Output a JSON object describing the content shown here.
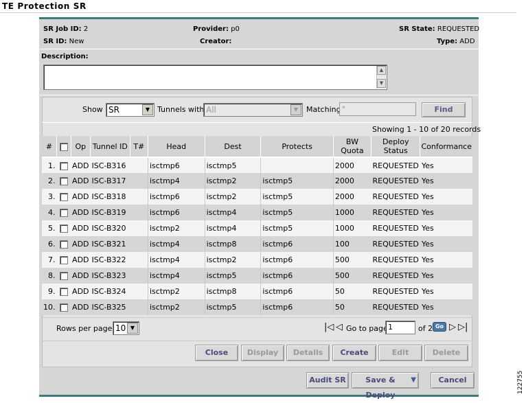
{
  "page": {
    "title": "TE Protection SR",
    "figure_number": "122755"
  },
  "header": {
    "sr_job_id_label": "SR Job ID:",
    "sr_job_id": "2",
    "provider_label": "Provider:",
    "provider": "p0",
    "sr_state_label": "SR State:",
    "sr_state": "REQUESTED",
    "sr_id_label": "SR ID:",
    "sr_id": "New",
    "creator_label": "Creator:",
    "creator": "",
    "type_label": "Type:",
    "type": "ADD"
  },
  "description": {
    "label": "Description:",
    "value": ""
  },
  "filter": {
    "show_label": "Show",
    "show_value": "SR",
    "tunnels_label": "Tunnels with",
    "tunnels_value": "All",
    "matching_label": "Matching",
    "matching_placeholder": "*",
    "find_label": "Find"
  },
  "records_text": "Showing 1 - 10 of 20 records",
  "table": {
    "columns": [
      "#",
      "",
      "Op",
      "Tunnel ID",
      "T#",
      "Head",
      "Dest",
      "Protects",
      "BW Quota",
      "Deploy Status",
      "Conformance"
    ],
    "rows": [
      {
        "n": "1.",
        "op": "ADD",
        "tunnel": "ISC-B316",
        "t": "",
        "head": "isctmp6",
        "dest": "isctmp5",
        "protects": "",
        "bw": "2000",
        "status": "REQUESTED",
        "conf": "Yes"
      },
      {
        "n": "2.",
        "op": "ADD",
        "tunnel": "ISC-B317",
        "t": "",
        "head": "isctmp4",
        "dest": "isctmp2",
        "protects": "isctmp5",
        "bw": "2000",
        "status": "REQUESTED",
        "conf": "Yes"
      },
      {
        "n": "3.",
        "op": "ADD",
        "tunnel": "ISC-B318",
        "t": "",
        "head": "isctmp6",
        "dest": "isctmp2",
        "protects": "isctmp5",
        "bw": "2000",
        "status": "REQUESTED",
        "conf": "Yes"
      },
      {
        "n": "4.",
        "op": "ADD",
        "tunnel": "ISC-B319",
        "t": "",
        "head": "isctmp6",
        "dest": "isctmp4",
        "protects": "isctmp5",
        "bw": "1000",
        "status": "REQUESTED",
        "conf": "Yes"
      },
      {
        "n": "5.",
        "op": "ADD",
        "tunnel": "ISC-B320",
        "t": "",
        "head": "isctmp2",
        "dest": "isctmp4",
        "protects": "isctmp5",
        "bw": "1000",
        "status": "REQUESTED",
        "conf": "Yes"
      },
      {
        "n": "6.",
        "op": "ADD",
        "tunnel": "ISC-B321",
        "t": "",
        "head": "isctmp4",
        "dest": "isctmp8",
        "protects": "isctmp6",
        "bw": "100",
        "status": "REQUESTED",
        "conf": "Yes"
      },
      {
        "n": "7.",
        "op": "ADD",
        "tunnel": "ISC-B322",
        "t": "",
        "head": "isctmp4",
        "dest": "isctmp2",
        "protects": "isctmp6",
        "bw": "500",
        "status": "REQUESTED",
        "conf": "Yes"
      },
      {
        "n": "8.",
        "op": "ADD",
        "tunnel": "ISC-B323",
        "t": "",
        "head": "isctmp4",
        "dest": "isctmp5",
        "protects": "isctmp6",
        "bw": "500",
        "status": "REQUESTED",
        "conf": "Yes"
      },
      {
        "n": "9.",
        "op": "ADD",
        "tunnel": "ISC-B324",
        "t": "",
        "head": "isctmp2",
        "dest": "isctmp8",
        "protects": "isctmp6",
        "bw": "50",
        "status": "REQUESTED",
        "conf": "Yes"
      },
      {
        "n": "10.",
        "op": "ADD",
        "tunnel": "ISC-B325",
        "t": "",
        "head": "isctmp2",
        "dest": "isctmp5",
        "protects": "isctmp6",
        "bw": "50",
        "status": "REQUESTED",
        "conf": "Yes"
      }
    ]
  },
  "pagination": {
    "rows_per_page_label": "Rows per page:",
    "rows_per_page": "10",
    "goto_label": "Go to page:",
    "goto_value": "1",
    "of_label": "of 2",
    "go_label": "Go"
  },
  "actions": {
    "close": "Close",
    "display": "Display",
    "details": "Details",
    "create": "Create",
    "edit": "Edit",
    "delete": "Delete"
  },
  "footer": {
    "audit": "Audit SR",
    "save_deploy": "Save & Deploy",
    "cancel": "Cancel"
  }
}
